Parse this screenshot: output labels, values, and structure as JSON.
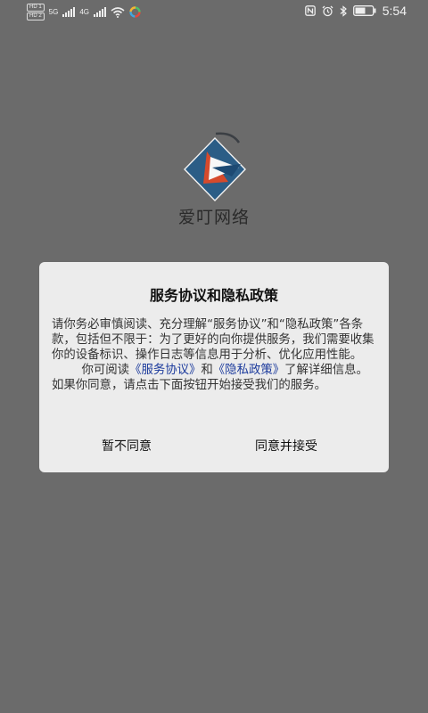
{
  "status_bar": {
    "hd1": "HD 1",
    "hd2": "HD 2",
    "net": "5G",
    "net2": "4G",
    "time": "5:54"
  },
  "app": {
    "name": "爱叮网络"
  },
  "dialog": {
    "title": "服务协议和隐私政策",
    "para1": "请你务必审慎阅读、充分理解“服务协议”和“隐私政策”各条款，包括但不限于：为了更好的向你提供服务，我们需要收集你的设备标识、操作日志等信息用于分析、优化应用性能。",
    "para2_pre": "你可阅读",
    "link_service": "《服务协议》",
    "para2_and": "和",
    "link_privacy": "《隐私政策》",
    "para2_post": "了解详细信息。如果你同意，请点击下面按钮开始接受我们的服务。",
    "btn_disagree": "暂不同意",
    "btn_agree": "同意并接受"
  },
  "colors": {
    "overlay": "#6b6b6b",
    "dialog_bg": "#ececec",
    "link": "#1b3a9c"
  }
}
